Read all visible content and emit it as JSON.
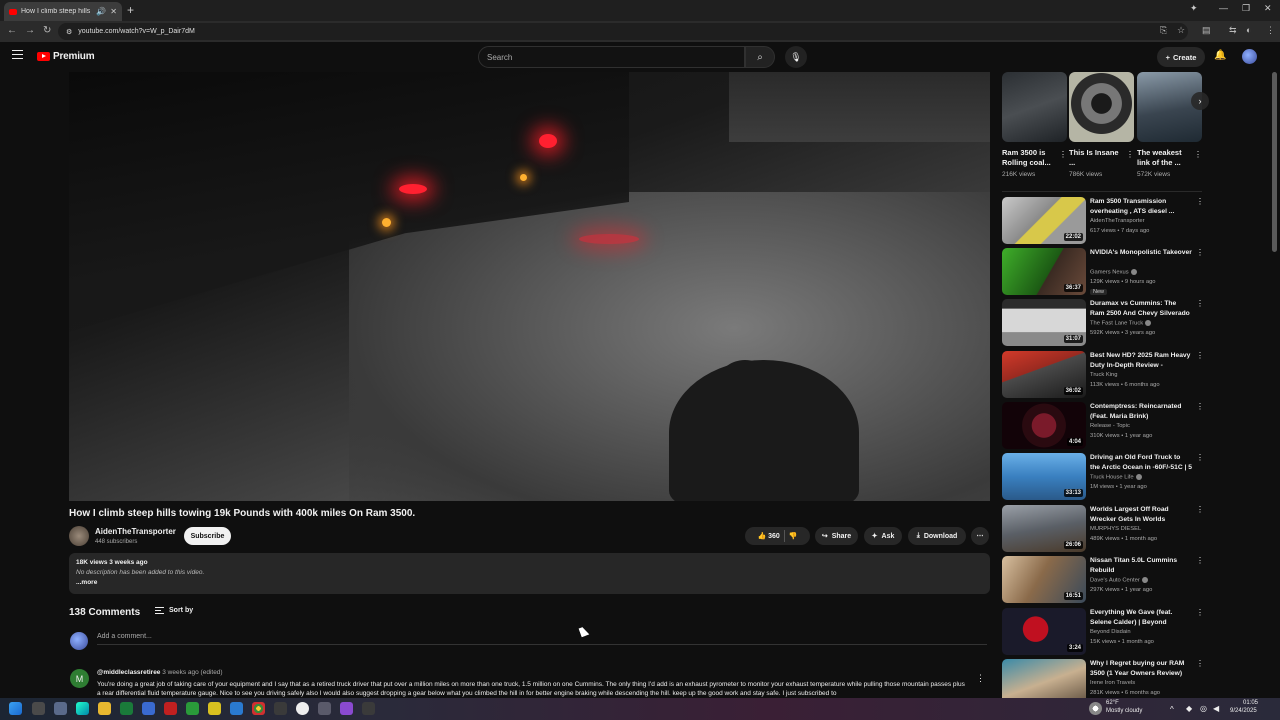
{
  "browser": {
    "tab_title": "How I climb steep hills tow",
    "url": "youtube.com/watch?v=W_p_Dair7dM"
  },
  "header": {
    "brand": "Premium",
    "search_placeholder": "Search",
    "create_label": "Create"
  },
  "video": {
    "title": "How I climb steep hills towing 19k Pounds with 400k miles On Ram 3500.",
    "channel": "AidenTheTransporter",
    "subscribers": "448 subscribers",
    "subscribe_label": "Subscribe",
    "likes": "360",
    "share_label": "Share",
    "ask_label": "Ask",
    "download_label": "Download",
    "views_date": "18K views  3 weeks ago",
    "description": "No description has been added to this video.",
    "more_label": "...more"
  },
  "comments": {
    "count": "138 Comments",
    "sort_label": "Sort by",
    "add_placeholder": "Add a comment...",
    "first": {
      "avatar_letter": "M",
      "author": "@middleclassretiree",
      "meta": "3 weeks ago (edited)",
      "text": "You're doing a great job of taking care of your equipment and I say that as a retired truck driver that put over a million miles on more than one truck, 1.5 million on one Cummins. The only thing I'd add is an exhaust pyrometer to monitor your exhaust temperature while pulling those mountain passes plus a rear differential fluid temperature gauge. Nice to see you driving safely also I would also suggest dropping a gear  below what you climbed the hill in for better engine braking while descending the hill. keep up the good work and stay safe. I just subscribed to"
    }
  },
  "shorts": [
    {
      "title": "Ram 3500 is Rolling coal...",
      "views": "216K views"
    },
    {
      "title": "This Is Insane ...",
      "views": "786K views"
    },
    {
      "title": "The weakest link of the ...",
      "views": "572K views"
    }
  ],
  "related": [
    {
      "title": "Ram 3500 Transmission overheating , ATS diesel ...",
      "channel": "AidenTheTransporter",
      "meta": "617 views • 7 days ago",
      "duration": "22:02",
      "verified": false,
      "badge": ""
    },
    {
      "title": "NVIDIA's Monopolistic Takeover",
      "channel": "Gamers Nexus",
      "meta": "129K views • 9 hours ago",
      "duration": "36:37",
      "verified": true,
      "badge": "New"
    },
    {
      "title": "Duramax vs Cummins: The Ram 2500 And Chevy Silverado 250...",
      "channel": "The Fast Lane Truck",
      "meta": "592K views • 3 years ago",
      "duration": "31:07",
      "verified": true,
      "badge": ""
    },
    {
      "title": "Best New HD? 2025 Ram Heavy Duty In-Depth Review - Towing...",
      "channel": "Truck King",
      "meta": "113K views • 6 months ago",
      "duration": "36:02",
      "verified": false,
      "badge": ""
    },
    {
      "title": "Contemptress: Reincarnated (Feat. Maria Brink)",
      "channel": "Release - Topic",
      "meta": "310K views • 1 year ago",
      "duration": "4:04",
      "verified": false,
      "badge": ""
    },
    {
      "title": "Driving an Old Ford Truck to the Arctic Ocean in -60F/-51C | 5 ...",
      "channel": "Truck House Life",
      "meta": "1M views • 1 year ago",
      "duration": "33:13",
      "verified": true,
      "badge": ""
    },
    {
      "title": "Worlds Largest Off Road Wrecker Gets In Worlds sh!tties...",
      "channel": "MURPHYS DIESEL",
      "meta": "489K views • 1 month ago",
      "duration": "26:06",
      "verified": false,
      "badge": ""
    },
    {
      "title": "Nissan Titan 5.0L Cummins Rebuild",
      "channel": "Dave's Auto Center",
      "meta": "297K views • 1 year ago",
      "duration": "16:51",
      "verified": true,
      "badge": ""
    },
    {
      "title": "Everything We Gave (feat. Selene Calder) | Beyond Disdai...",
      "channel": "Beyond Disdain",
      "meta": "15K views • 1 month ago",
      "duration": "3:24",
      "verified": false,
      "badge": ""
    },
    {
      "title": "Why I Regret buying our RAM 3500 (1 Year Owners Review)",
      "channel": "Irene Iron Travels",
      "meta": "281K views • 6 months ago",
      "duration": "",
      "verified": false,
      "badge": ""
    }
  ],
  "taskbar": {
    "weather_temp": "62°F",
    "weather_desc": "Mostly cloudy",
    "time": "01:05",
    "date": "9/24/2025"
  }
}
